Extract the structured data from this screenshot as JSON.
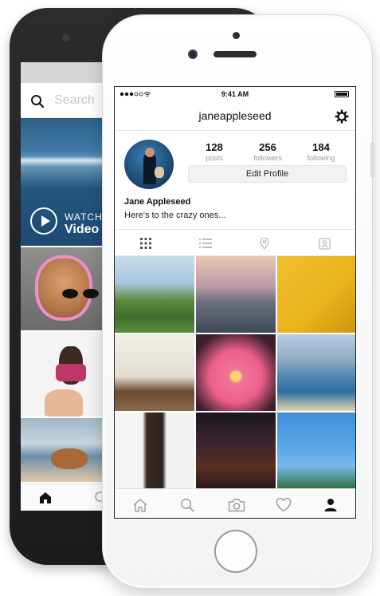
{
  "back_phone": {
    "search": {
      "placeholder": "Search"
    },
    "video_tile": {
      "watch_label": "WATCH",
      "title": "Video"
    }
  },
  "front_phone": {
    "status_bar": {
      "time": "9:41 AM"
    },
    "profile": {
      "username": "janeappleseed",
      "stats": {
        "posts": {
          "value": "128",
          "label": "posts"
        },
        "followers": {
          "value": "256",
          "label": "followers"
        },
        "following": {
          "value": "184",
          "label": "following"
        }
      },
      "edit_button": "Edit Profile",
      "full_name": "Jane Appleseed",
      "bio": "Here's to the crazy ones..."
    },
    "tabs": [
      "grid-icon",
      "list-icon",
      "location-pin-icon",
      "tagged-icon"
    ],
    "bottom_bar": [
      "home-icon",
      "search-icon",
      "camera-icon",
      "heart-icon",
      "profile-icon"
    ],
    "colors": {
      "text": "#111111",
      "muted": "#999999",
      "edit_button_bg": "#f2f2f2",
      "divider": "#e6e6e6"
    }
  }
}
